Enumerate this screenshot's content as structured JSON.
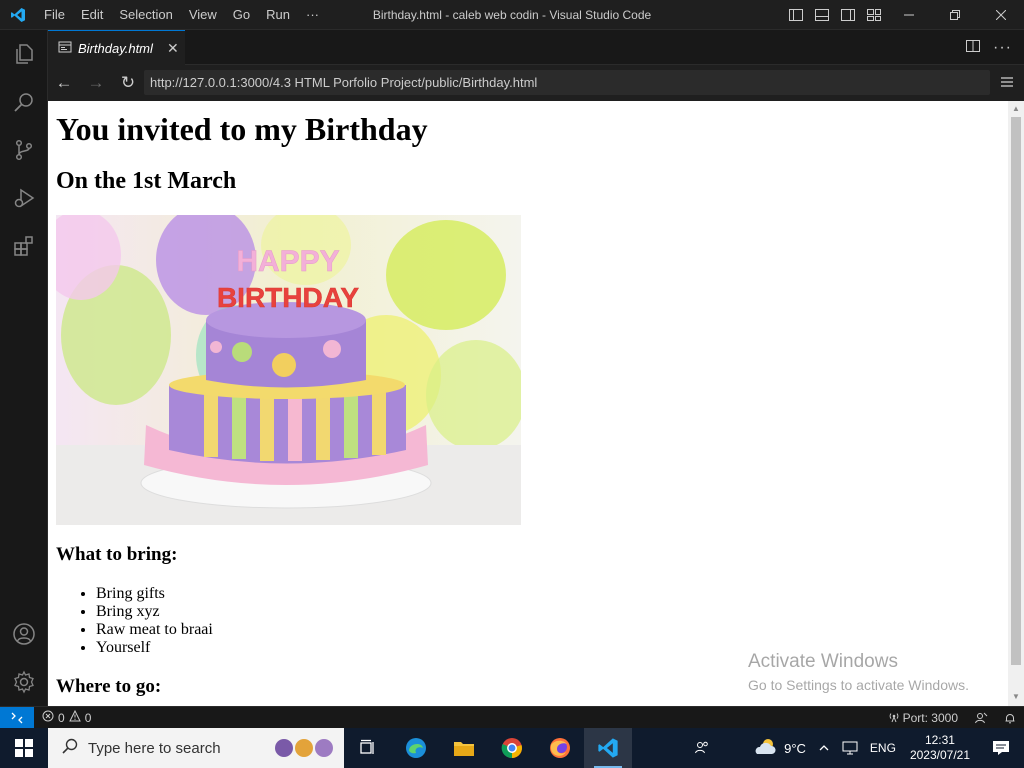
{
  "titlebar": {
    "menu": [
      "File",
      "Edit",
      "Selection",
      "View",
      "Go",
      "Run",
      "···"
    ],
    "window_title": "Birthday.html - caleb web codin - Visual Studio Code"
  },
  "tab": {
    "label": "Birthday.html"
  },
  "browser": {
    "url": "http://127.0.0.1:3000/4.3 HTML Porfolio Project/public/Birthday.html"
  },
  "page": {
    "h1": "You invited to my Birthday",
    "h2": "On the 1st March",
    "image_text": "HAPPY BIRTHDAY",
    "what_to_bring_heading": "What to bring:",
    "items": [
      "Bring gifts",
      "Bring xyz",
      "Raw meat to braai",
      "Yourself"
    ],
    "where_heading": "Where to go:"
  },
  "watermark": {
    "line1": "Activate Windows",
    "line2": "Go to Settings to activate Windows."
  },
  "statusbar": {
    "errors": "0",
    "warnings": "0",
    "port": "Port: 3000"
  },
  "taskbar": {
    "search_placeholder": "Type here to search",
    "temperature": "9°C",
    "language": "ENG",
    "time": "12:31",
    "date": "2023/07/21"
  },
  "colors": {
    "accent": "#0078d4",
    "titlebar_bg": "#1f1f1f",
    "taskbar_bg": "#0f1b2d"
  }
}
